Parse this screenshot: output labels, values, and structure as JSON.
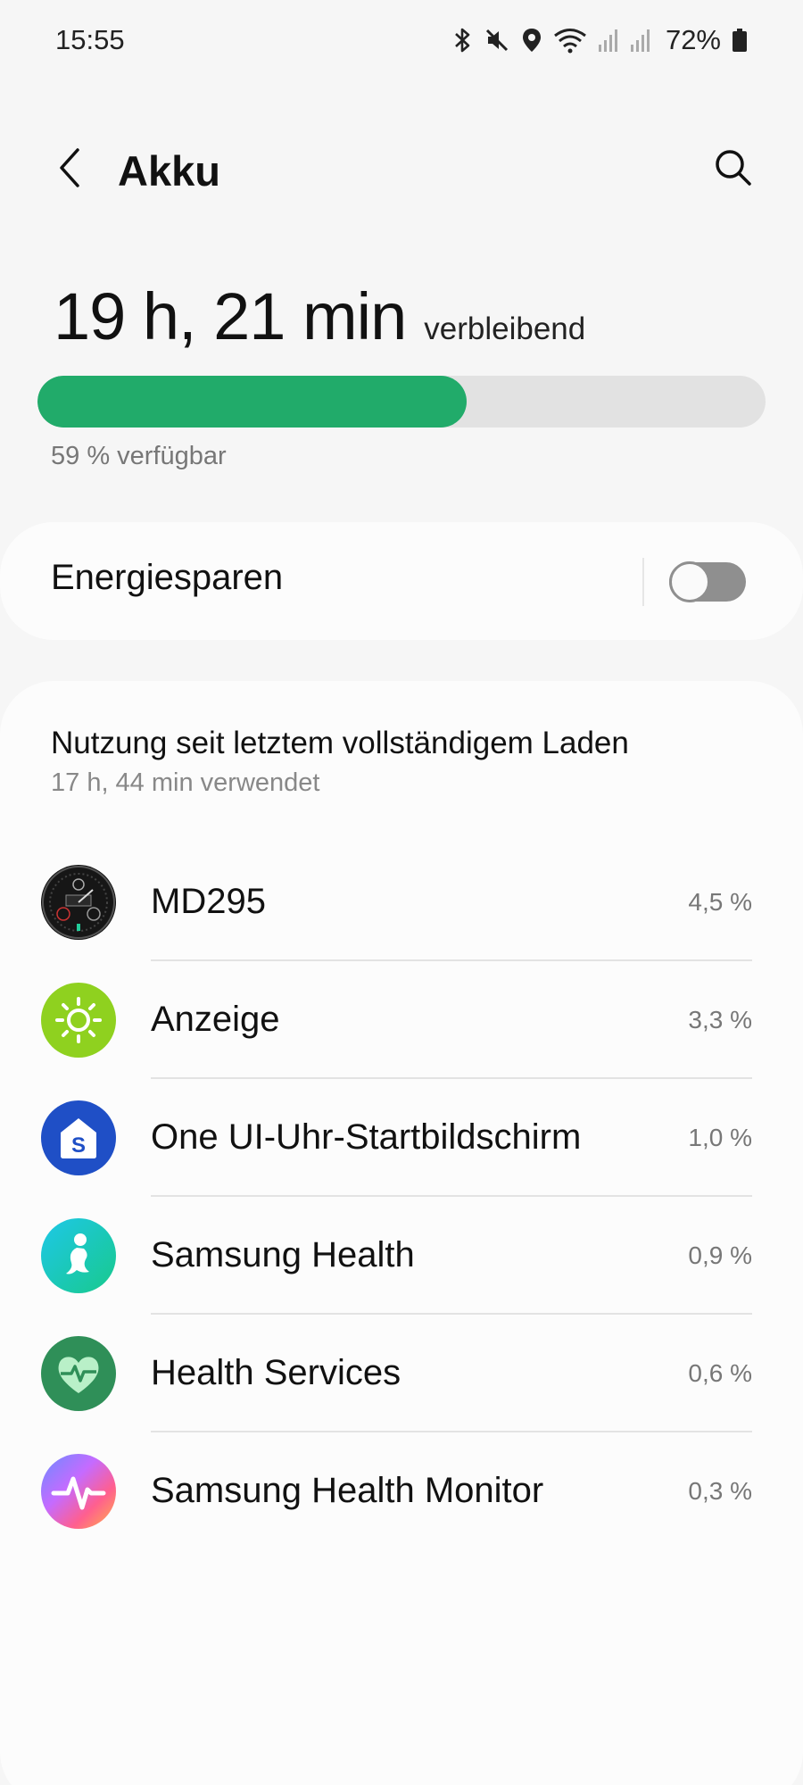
{
  "status_bar": {
    "time": "15:55",
    "battery_percent": "72%"
  },
  "header": {
    "title": "Akku",
    "back_icon": "chevron-left-icon",
    "search_icon": "search-icon"
  },
  "battery": {
    "remaining_time": "19 h, 21 min",
    "remaining_label": "verbleibend",
    "level_percent": 59,
    "available_text": "59 % verfügbar",
    "fill_color": "#21ab6a"
  },
  "power_saving": {
    "label": "Energiesparen",
    "enabled": false
  },
  "usage": {
    "title": "Nutzung seit letztem vollständigem Laden",
    "subtitle": "17 h, 44 min verwendet",
    "apps": [
      {
        "name": "MD295",
        "value": "4,5 %"
      },
      {
        "name": "Anzeige",
        "value": "3,3 %"
      },
      {
        "name": "One UI-Uhr-Startbildschirm",
        "value": "1,0 %"
      },
      {
        "name": "Samsung Health",
        "value": "0,9 %"
      },
      {
        "name": "Health Services",
        "value": "0,6 %"
      },
      {
        "name": "Samsung Health Monitor",
        "value": "0,3 %"
      }
    ]
  }
}
